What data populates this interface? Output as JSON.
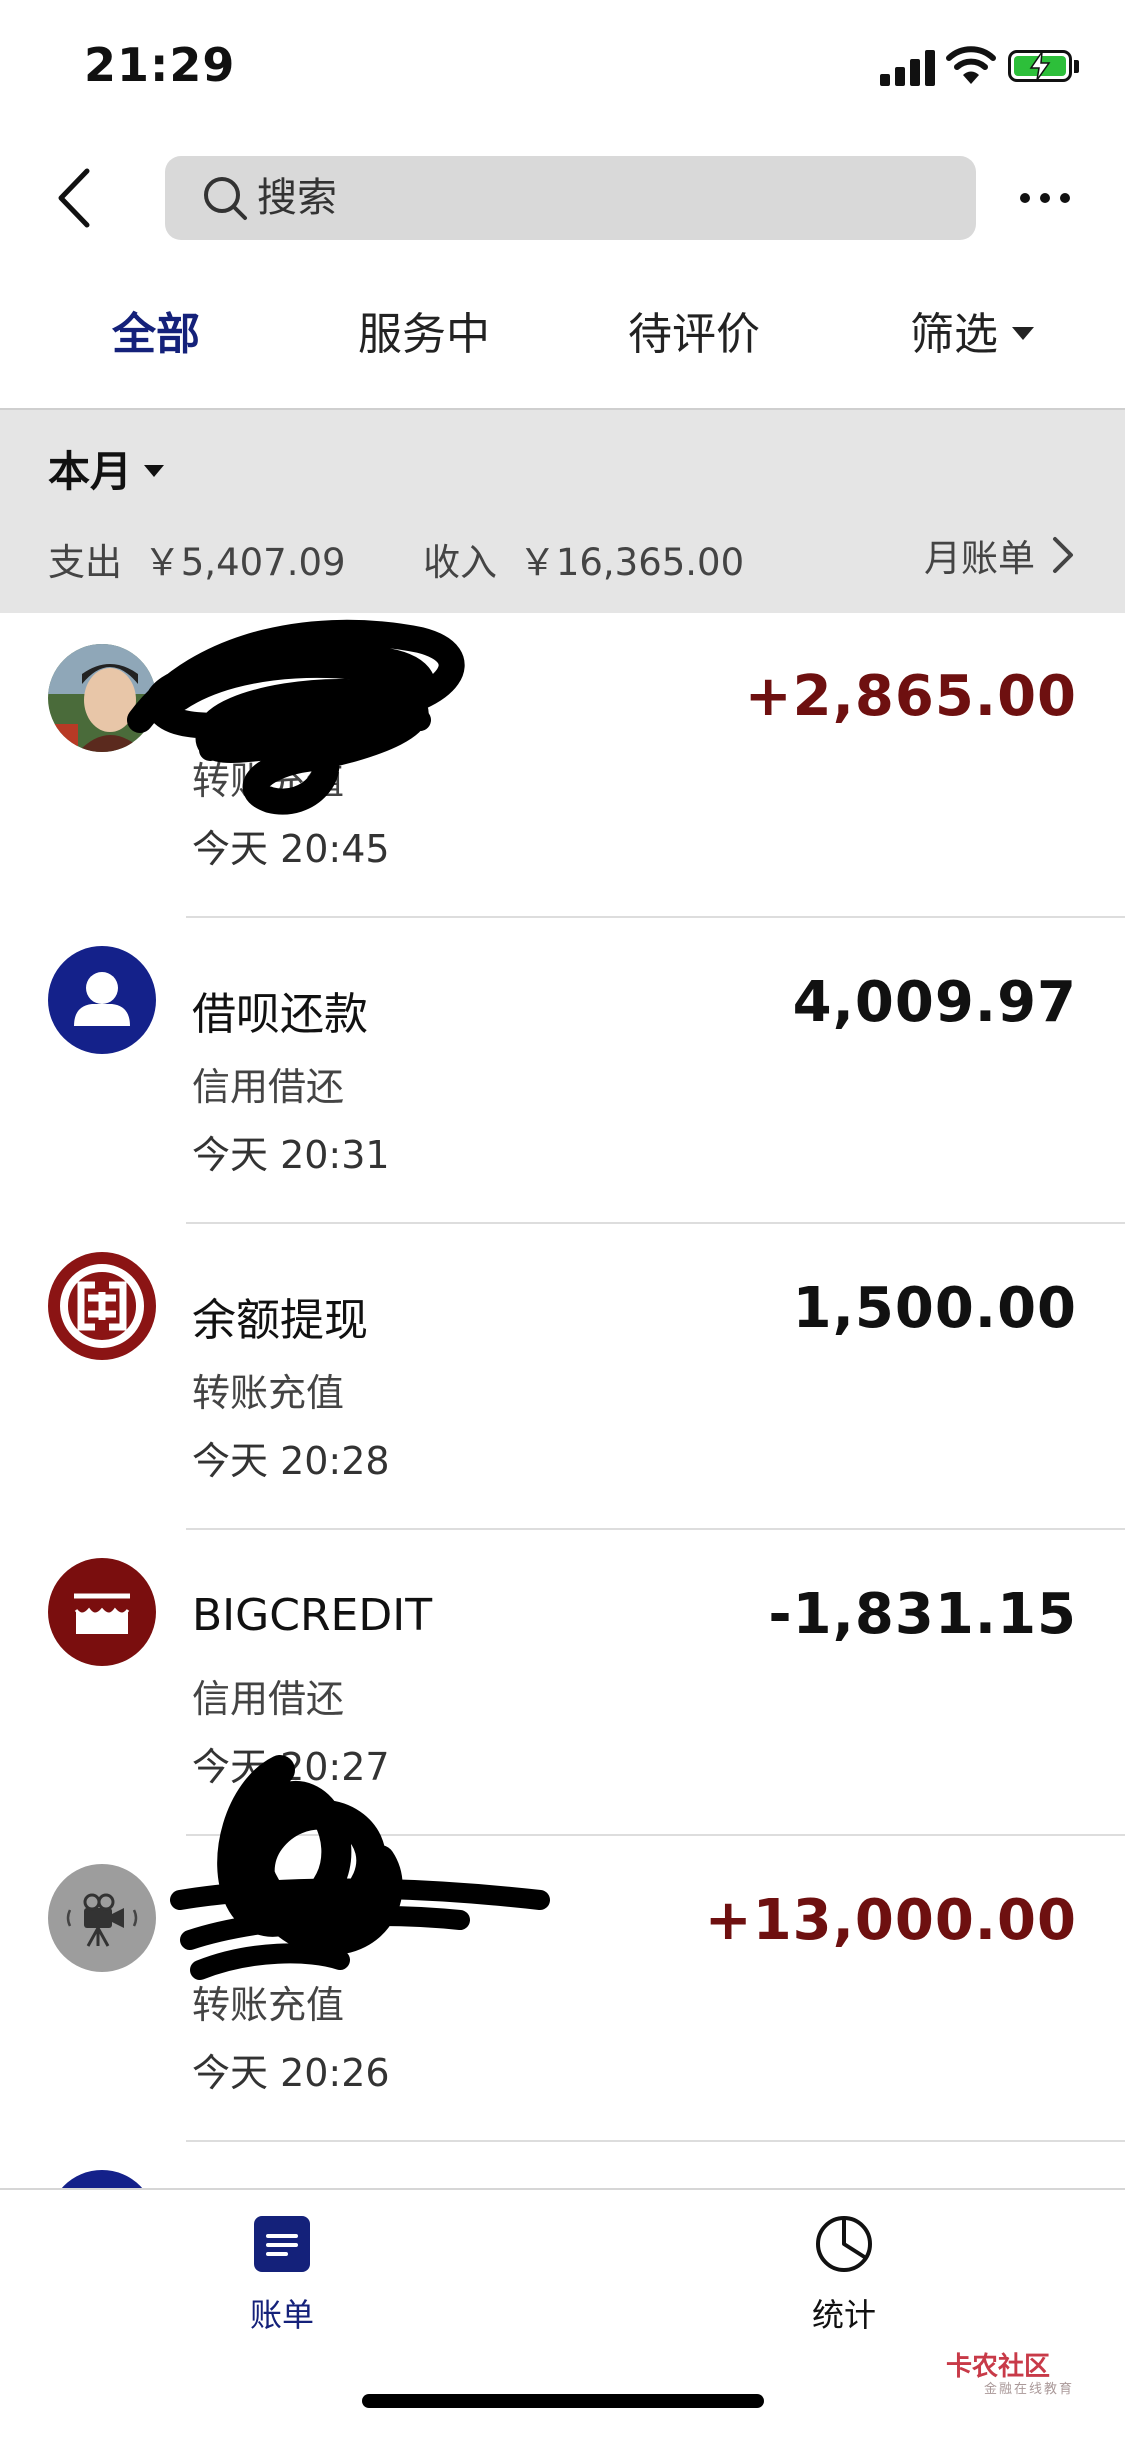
{
  "status_bar": {
    "time": "21:29"
  },
  "search": {
    "placeholder": "搜索"
  },
  "tabs": [
    {
      "label": "全部",
      "active": true
    },
    {
      "label": "服务中",
      "active": false
    },
    {
      "label": "待评价",
      "active": false
    },
    {
      "label": "筛选",
      "active": false
    }
  ],
  "month": {
    "label": "本月",
    "expense_label": "支出",
    "expense_value": "￥5,407.09",
    "income_label": "收入",
    "income_value": "￥16,365.00",
    "monthly_bill": "月账单"
  },
  "transactions": [
    {
      "name": "",
      "category": "转账充值",
      "time": "今天  20:45",
      "amount": "+2,865.00",
      "type": "income",
      "icon": "user-photo-avatar"
    },
    {
      "name": "借呗还款",
      "category": "信用借还",
      "time": "今天  20:31",
      "amount": "4,009.97",
      "type": "neutral",
      "icon": "person-icon"
    },
    {
      "name": "余额提现",
      "category": "转账充值",
      "time": "今天  20:28",
      "amount": "1,500.00",
      "type": "neutral",
      "icon": "icbc-bank-icon"
    },
    {
      "name": "BIGCREDIT",
      "category": "信用借还",
      "time": "今天  20:27",
      "amount": "-1,831.15",
      "type": "expense",
      "icon": "store-icon"
    },
    {
      "name": "",
      "category": "转账充值",
      "time": "今天  20:26",
      "amount": "+13,000.00",
      "type": "income",
      "icon": "camera-icon"
    }
  ],
  "tabbar": [
    {
      "label": "账单",
      "active": true,
      "icon": "bill-icon"
    },
    {
      "label": "统计",
      "active": false,
      "icon": "pie-chart-icon"
    }
  ],
  "watermark": {
    "text": "卡农社区",
    "sub": "金融在线教育"
  },
  "colors": {
    "accent": "#14217a",
    "income": "#6e1010",
    "icbc": "#8b1414",
    "store": "#7a0e0e"
  }
}
